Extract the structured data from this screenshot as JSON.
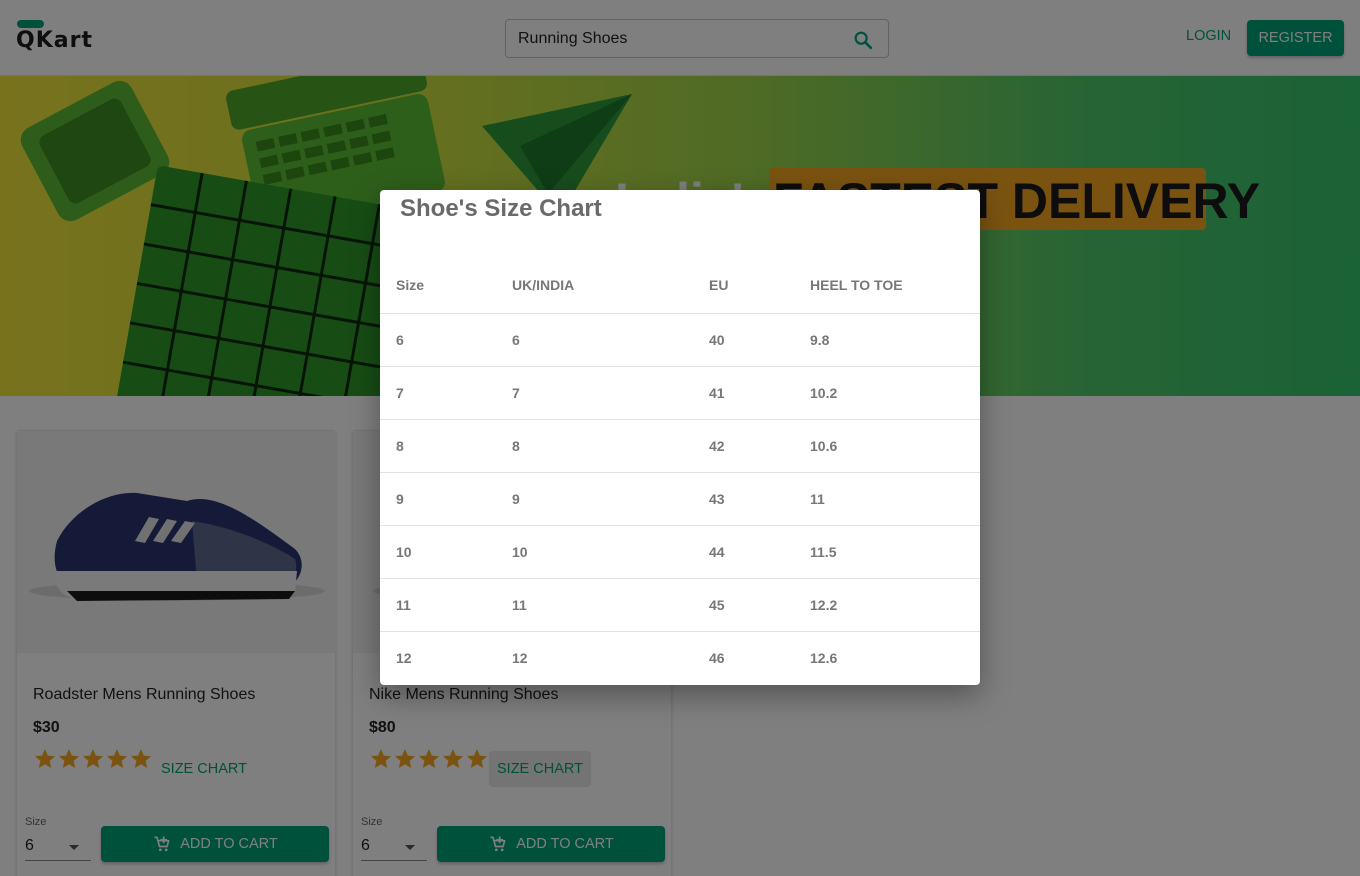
{
  "header": {
    "logo_text": "QKart",
    "search_value": "Running Shoes",
    "login_label": "LOGIN",
    "register_label": "REGISTER"
  },
  "hero": {
    "text_light": "India's",
    "text_highlight": "FASTEST DELIVERY"
  },
  "products": [
    {
      "name": "Roadster Mens Running Shoes",
      "price": "$30",
      "rating": 5,
      "size_chart_label": "SIZE CHART",
      "size_label": "Size",
      "size_value": "6",
      "add_to_cart_label": "ADD TO CART"
    },
    {
      "name": "Nike Mens Running Shoes",
      "price": "$80",
      "rating": 5,
      "size_chart_label": "SIZE CHART",
      "size_label": "Size",
      "size_value": "6",
      "add_to_cart_label": "ADD TO CART"
    }
  ],
  "modal": {
    "title": "Shoe's Size Chart",
    "headers": [
      "Size",
      "UK/INDIA",
      "EU",
      "HEEL TO TOE"
    ],
    "rows": [
      [
        "6",
        "6",
        "40",
        "9.8"
      ],
      [
        "7",
        "7",
        "41",
        "10.2"
      ],
      [
        "8",
        "8",
        "42",
        "10.6"
      ],
      [
        "9",
        "9",
        "43",
        "11"
      ],
      [
        "10",
        "10",
        "44",
        "11.5"
      ],
      [
        "11",
        "11",
        "45",
        "12.2"
      ],
      [
        "12",
        "12",
        "46",
        "12.6"
      ]
    ]
  },
  "colors": {
    "brand": "#00a278",
    "star": "#f5a623",
    "highlight": "#f5a623"
  }
}
